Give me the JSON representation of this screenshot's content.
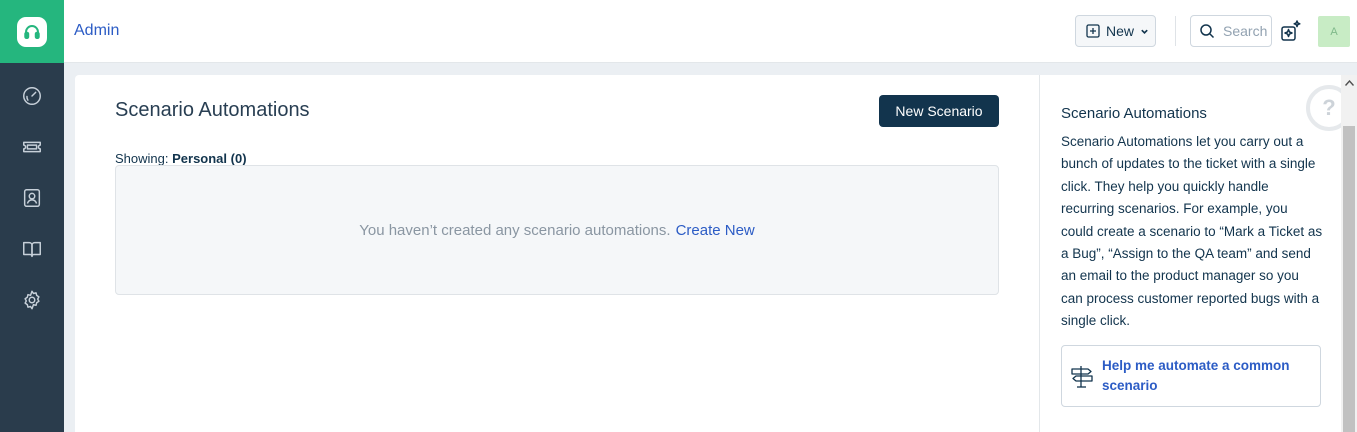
{
  "nav": {
    "items": [
      {
        "name": "dashboard"
      },
      {
        "name": "tickets"
      },
      {
        "name": "contacts"
      },
      {
        "name": "solutions"
      },
      {
        "name": "admin"
      }
    ]
  },
  "header": {
    "title": "Admin",
    "new_label": "New",
    "search_placeholder": "Search",
    "avatar_initial": "A"
  },
  "main": {
    "page_title": "Scenario Automations",
    "new_scenario_label": "New Scenario",
    "showing_prefix": "Showing:",
    "showing_value": "Personal (0)",
    "empty_message": "You haven’t created any scenario automations.",
    "create_new_link": "Create New"
  },
  "side": {
    "title": "Scenario Automations",
    "description": "Scenario Automations let you carry out a bunch of updates to the ticket with a single click. They help you quickly handle recurring scenarios. For example, you could create a scenario to “Mark a Ticket as a Bug”, “Assign to the QA team” and send an email to the product manager so you can process customer reported bugs with a single click.",
    "help_card_label": "Help me automate a common scenario",
    "help_bubble": "?"
  },
  "colors": {
    "brand_green": "#25b67e",
    "rail_dark": "#2a3c4c",
    "primary_button": "#12344d",
    "link_blue": "#2c5cc5"
  }
}
